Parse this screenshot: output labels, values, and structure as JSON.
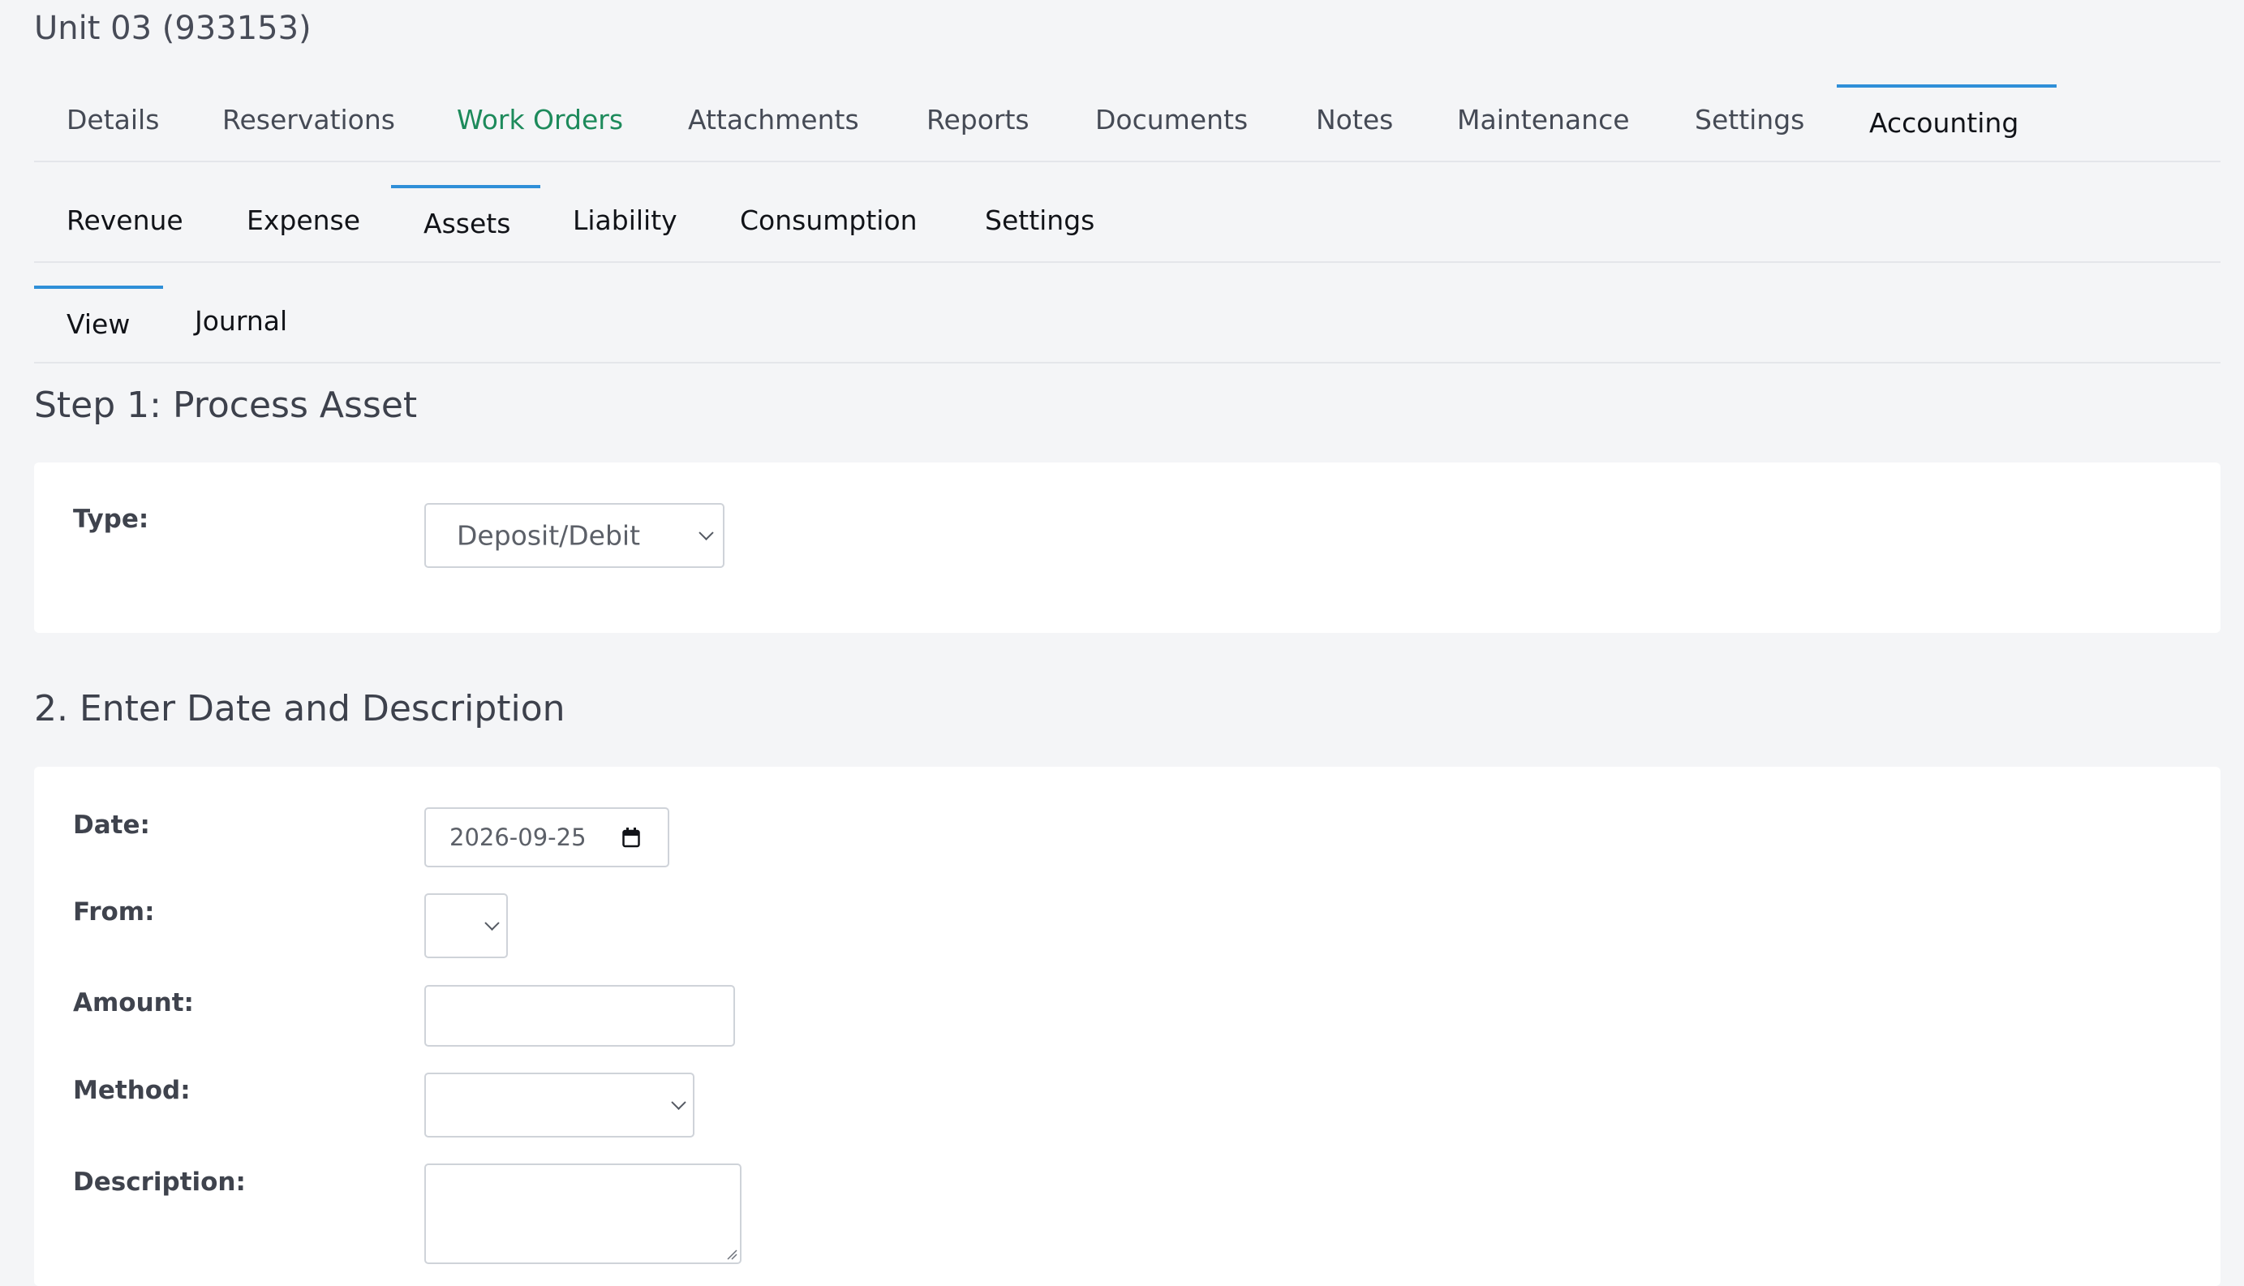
{
  "header": {
    "unit_title": "Unit 03 (933153)"
  },
  "main_tabs": [
    {
      "label": "Details"
    },
    {
      "label": "Reservations"
    },
    {
      "label": "Work Orders"
    },
    {
      "label": "Attachments"
    },
    {
      "label": "Reports"
    },
    {
      "label": "Documents"
    },
    {
      "label": "Notes"
    },
    {
      "label": "Maintenance"
    },
    {
      "label": "Settings"
    },
    {
      "label": "Accounting"
    }
  ],
  "accounting_tabs": [
    {
      "label": "Revenue"
    },
    {
      "label": "Expense"
    },
    {
      "label": "Assets"
    },
    {
      "label": "Liability"
    },
    {
      "label": "Consumption"
    },
    {
      "label": "Settings"
    }
  ],
  "asset_tabs": [
    {
      "label": "View"
    },
    {
      "label": "Journal"
    }
  ],
  "step1": {
    "title": "Step 1: Process Asset",
    "type_label": "Type:",
    "type_value": "Deposit/Debit"
  },
  "step2": {
    "title": "2. Enter Date and Description",
    "date_label": "Date:",
    "date_value": "2026-09-25",
    "from_label": "From:",
    "from_value": "",
    "amount_label": "Amount:",
    "amount_value": "",
    "method_label": "Method:",
    "method_value": "",
    "description_label": "Description:",
    "description_value": ""
  },
  "colors": {
    "page_background": "#f4f5f7",
    "active_tab_indicator": "#2f8fd8",
    "work_orders_tab_text": "#1d8a5b",
    "card_background": "#ffffff",
    "input_border": "#cfd3d9"
  }
}
